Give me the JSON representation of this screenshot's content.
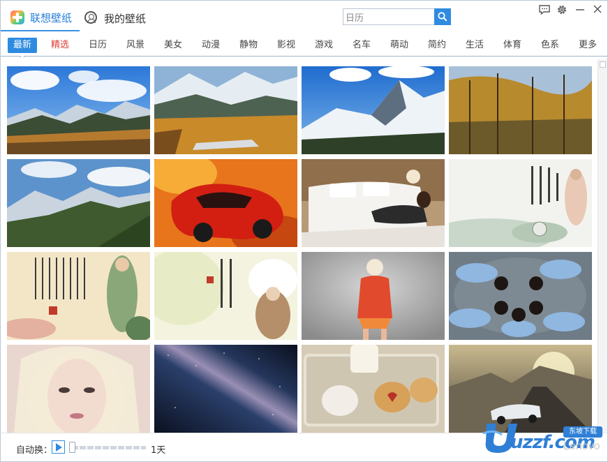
{
  "app": {
    "title": "联想壁纸",
    "my_wallpapers_tab": "我的壁纸"
  },
  "search": {
    "value": "日历",
    "placeholder": "日历"
  },
  "window_controls": [
    "feedback-icon",
    "gear-icon",
    "minimize-icon",
    "close-icon"
  ],
  "categories": [
    {
      "label": "最新",
      "state": "active"
    },
    {
      "label": "精选",
      "state": "highlight"
    },
    {
      "label": "日历"
    },
    {
      "label": "风景"
    },
    {
      "label": "美女"
    },
    {
      "label": "动漫"
    },
    {
      "label": "静物"
    },
    {
      "label": "影视"
    },
    {
      "label": "游戏"
    },
    {
      "label": "名车"
    },
    {
      "label": "萌动"
    },
    {
      "label": "简约"
    },
    {
      "label": "生活"
    },
    {
      "label": "体育"
    },
    {
      "label": "色系"
    },
    {
      "label": "更多"
    }
  ],
  "thumbnails": [
    {
      "subject": "mountain-landscape"
    },
    {
      "subject": "autumn-valley"
    },
    {
      "subject": "snowy-peaks"
    },
    {
      "subject": "larch-forest"
    },
    {
      "subject": "mountain-forest"
    },
    {
      "subject": "red-sports-car"
    },
    {
      "subject": "woman-on-bed"
    },
    {
      "subject": "guanyin-calligraphy"
    },
    {
      "subject": "guanyin-painting"
    },
    {
      "subject": "calligraphy-lotus"
    },
    {
      "subject": "woman-orange-dress"
    },
    {
      "subject": "girls-circle"
    },
    {
      "subject": "blonde-portrait"
    },
    {
      "subject": "milky-way"
    },
    {
      "subject": "cookies-milk"
    },
    {
      "subject": "racing-car-game"
    }
  ],
  "bottom": {
    "auto_change_label": "自动换：",
    "interval_label": "1天",
    "interval_position": 0
  },
  "watermark": {
    "text": "uzzf.com",
    "badge": "东坡下载",
    "brand": "Lenovo"
  },
  "colors": {
    "accent": "#2f8be0",
    "highlight_category": "#e03a2f",
    "title_text": "#2a7fd8"
  }
}
